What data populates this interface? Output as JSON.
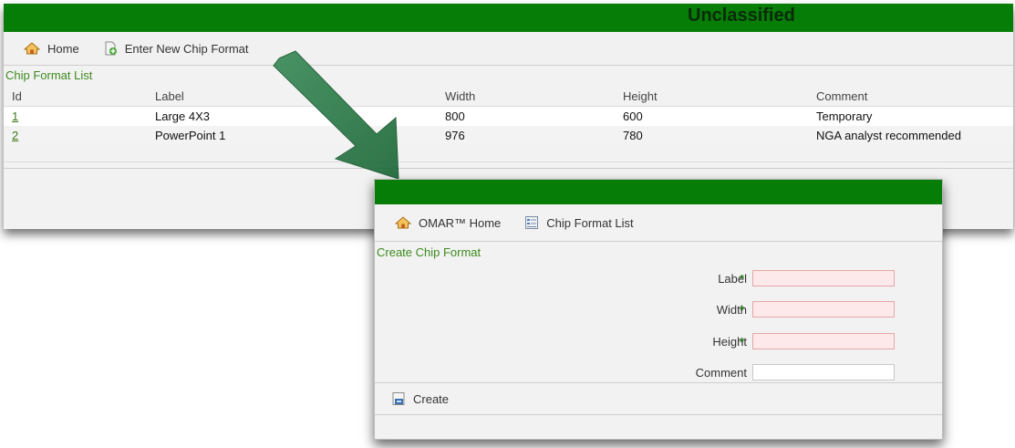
{
  "banner": {
    "classification": "Unclassified",
    "color": "#067d06"
  },
  "list_window": {
    "toolbar": {
      "home_label": "Home",
      "new_label": "Enter New Chip Format"
    },
    "section_title": "Chip Format List",
    "table": {
      "headers": [
        "Id",
        "Label",
        "Width",
        "Height",
        "Comment"
      ],
      "rows": [
        {
          "id": "1",
          "label": "Large 4X3",
          "width": "800",
          "height": "600",
          "comment": "Temporary"
        },
        {
          "id": "2",
          "label": "PowerPoint 1",
          "width": "976",
          "height": "780",
          "comment": "NGA analyst recommended"
        }
      ]
    }
  },
  "create_window": {
    "toolbar": {
      "home_label": "OMAR™ Home",
      "list_label": "Chip Format List"
    },
    "section_title": "Create Chip Format",
    "fields": {
      "label": {
        "label": "Label",
        "required_mark": "*",
        "value": ""
      },
      "width": {
        "label": "Width",
        "required_mark": "*",
        "value": ""
      },
      "height": {
        "label": "Height",
        "required_mark": "*",
        "value": ""
      },
      "comment": {
        "label": "Comment",
        "value": ""
      }
    },
    "create_button": "Create"
  },
  "icons": {
    "home": "home-icon",
    "new_document": "new-document-icon",
    "list": "list-icon",
    "save": "save-icon"
  },
  "colors": {
    "accent_green": "#3c8a1e",
    "required_field_bg": "#fde9e9",
    "arrow": "#2f7a4a"
  }
}
